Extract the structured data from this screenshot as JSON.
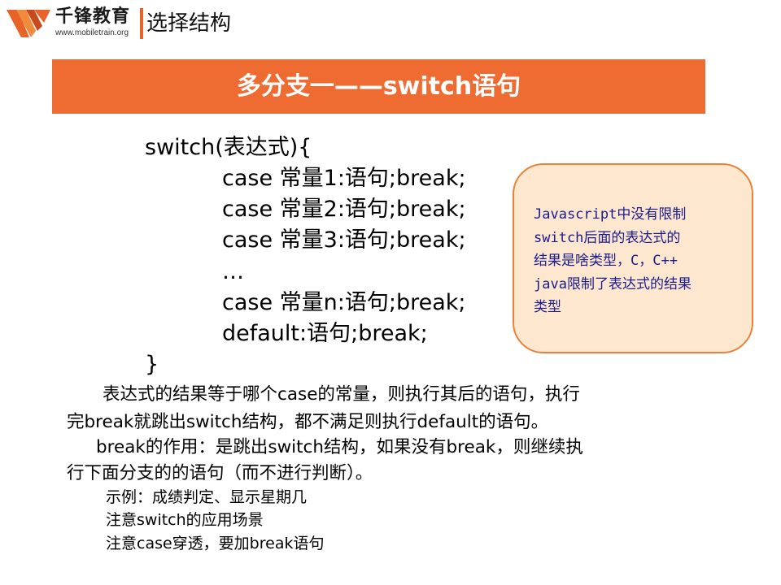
{
  "header": {
    "logo_name": "千锋教育",
    "logo_url": "www.mobiletrain.org",
    "title": "选择结构"
  },
  "banner": {
    "title": "多分支一——switch语句"
  },
  "code": {
    "lines": [
      "switch(表达式){",
      "case 常量1:语句;break;",
      "case 常量2:语句;break;",
      "case 常量3:语句;break;",
      "…",
      "case 常量n:语句;break;",
      "default:语句;break;",
      "}"
    ]
  },
  "callout": {
    "lines": [
      "Javascript中没有限制",
      "switch后面的表达式的",
      "结果是啥类型，C，C++",
      "java限制了表达式的结果",
      "类型"
    ]
  },
  "explanation": {
    "para1": [
      "表达式的结果等于哪个case的常量，则执行其后的语句，执行",
      "完break就跳出switch结构，都不满足则执行default的语句。"
    ],
    "para2": [
      "break的作用：是跳出switch结构，如果没有break，则继续执",
      "行下面分支的的语句（而不进行判断）。"
    ]
  },
  "notes": [
    "示例：成绩判定、显示星期几",
    "注意switch的应用场景",
    "注意case穿透，要加break语句"
  ],
  "colors": {
    "brand_orange": "#ee6b31",
    "callout_fill": "#fde7cf",
    "callout_border": "#e8823a",
    "callout_text": "#1b1b8c"
  }
}
